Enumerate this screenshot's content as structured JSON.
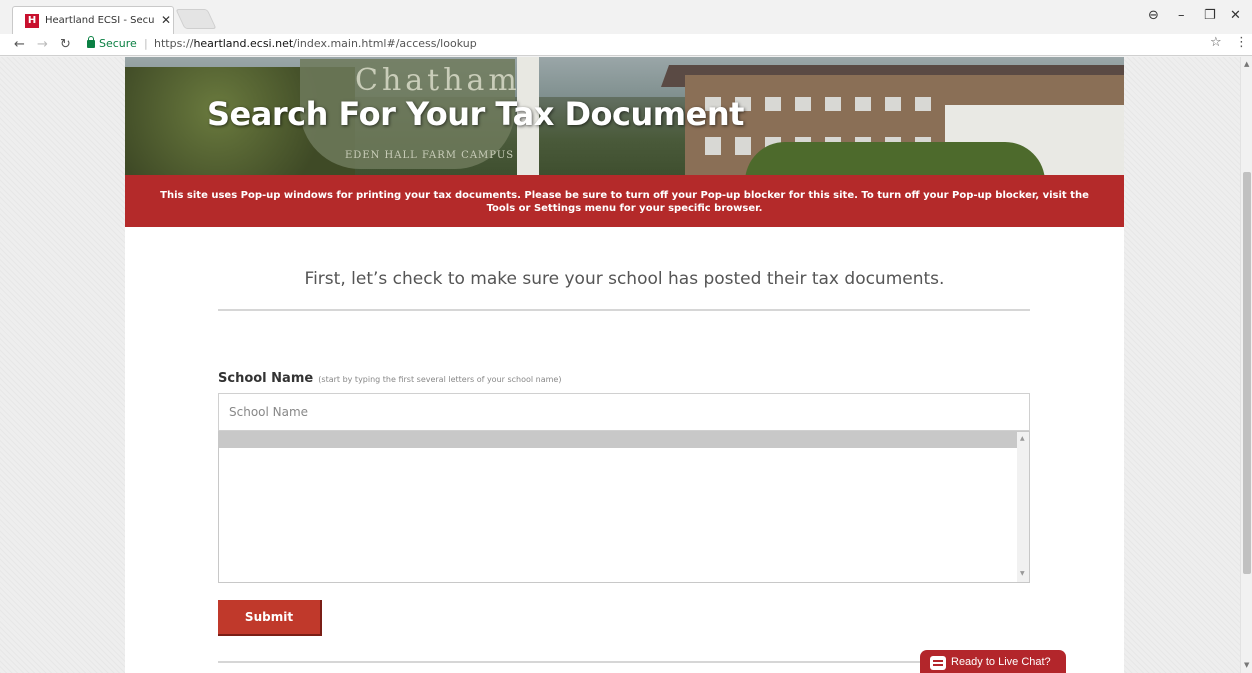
{
  "browser": {
    "tab_title": "Heartland ECSI - Secure I",
    "tab_favicon_letter": "H",
    "secure_label": "Secure",
    "url_scheme": "https://",
    "url_domain": "heartland.ecsi.net",
    "url_path": "/index.main.html#/access/lookup"
  },
  "hero": {
    "title": "Search For Your Tax Document",
    "sign_text": "Chatham",
    "sign_sub": "EDEN HALL FARM CAMPUS"
  },
  "notice": {
    "text": "This site uses Pop-up windows for printing your tax documents. Please be sure to turn off your Pop-up blocker for this site. To turn off your Pop-up blocker, visit the Tools or Settings menu for your specific browser."
  },
  "form": {
    "intro": "First, let’s check to make sure your school has posted their tax documents.",
    "field_label": "School Name",
    "field_hint": "(start by typing the first several letters of your school name)",
    "school_placeholder": "School Name",
    "school_value": "",
    "submit_label": "Submit"
  },
  "chat": {
    "label": "Ready to Live Chat?"
  },
  "colors": {
    "brand_red": "#b42a2a",
    "submit_red": "#c0392b",
    "secure_green": "#0b8043"
  }
}
